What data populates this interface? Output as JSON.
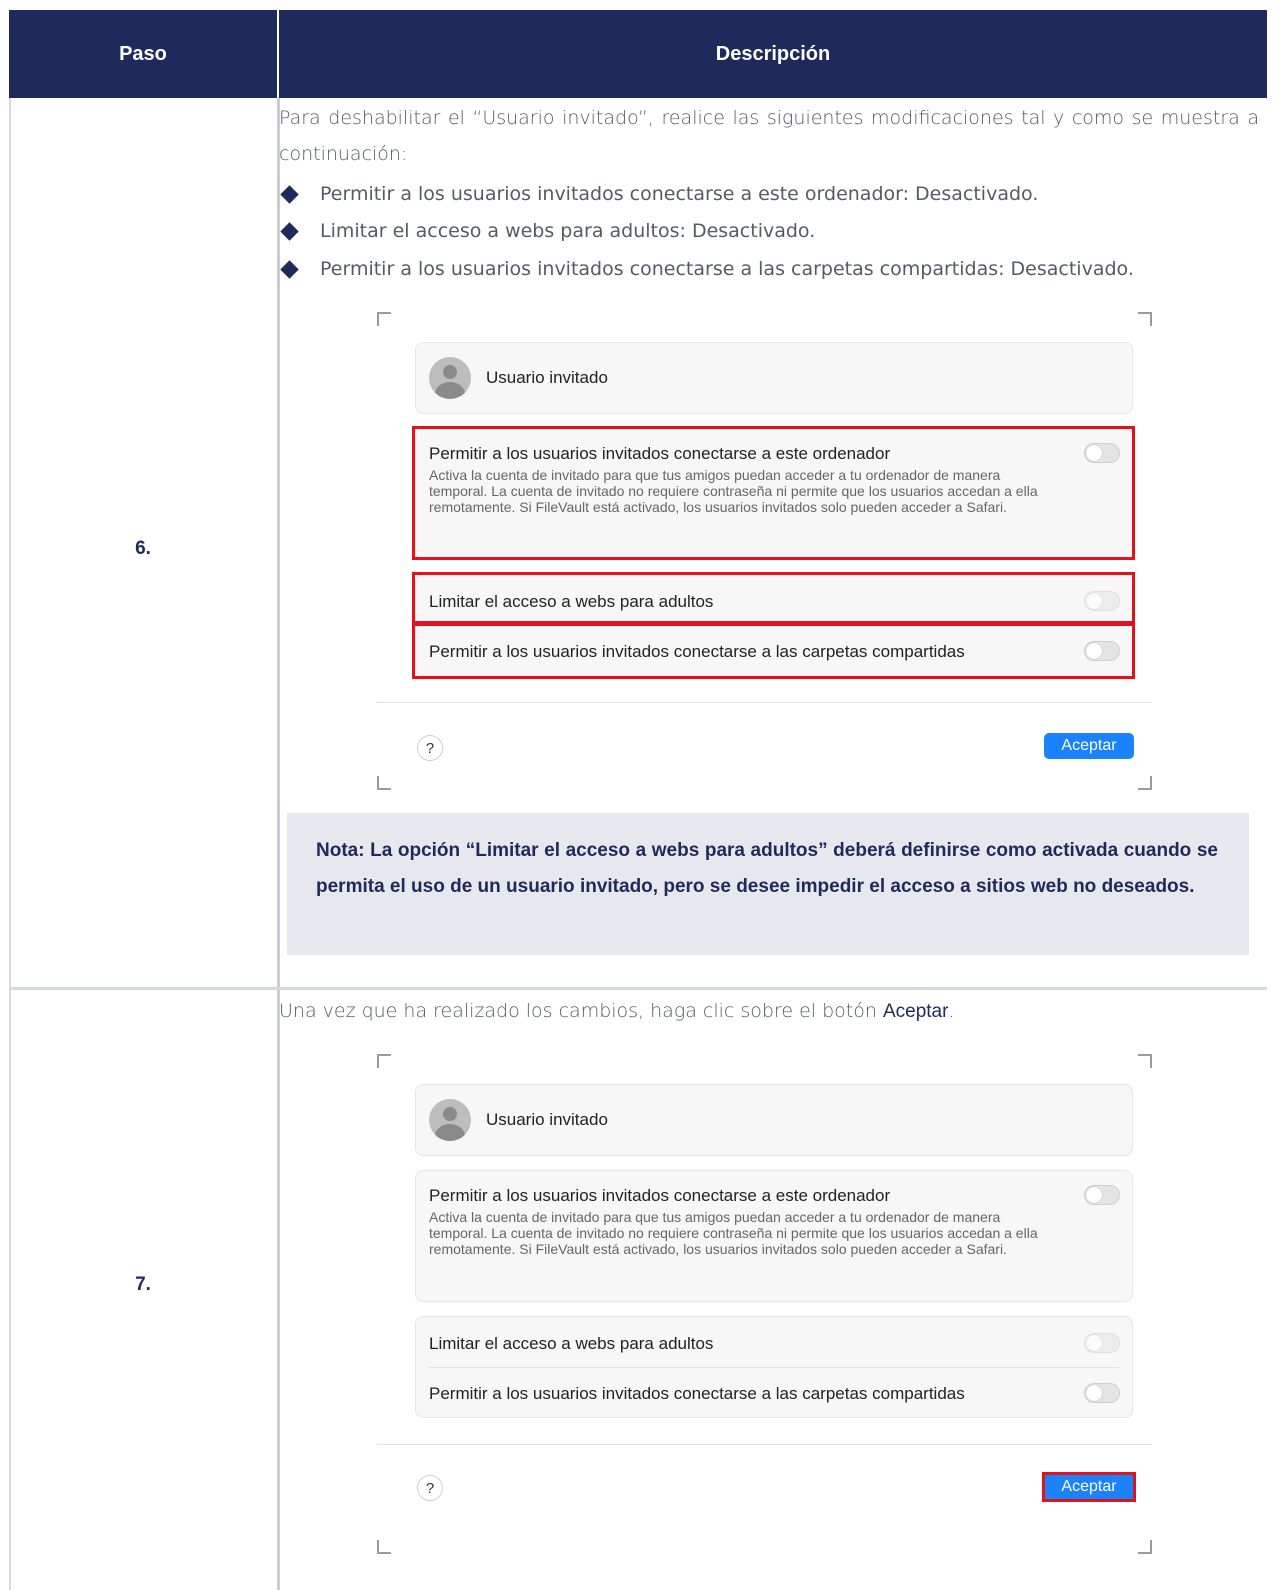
{
  "table": {
    "header": {
      "step": "Paso",
      "description": "Descripción"
    }
  },
  "step6": {
    "number": "6.",
    "intro": "Para deshabilitar el “Usuario invitado”, realice las siguientes modificaciones tal y como se muestra a continuación:",
    "bullets": [
      "Permitir a los usuarios invitados conectarse a este ordenador: Desactivado.",
      "Limitar el acceso a webs para adultos: Desactivado.",
      "Permitir a los usuarios invitados conectarse a las carpetas compartidas: Desactivado."
    ],
    "note": "Nota: La opción “Limitar el acceso a webs para adultos” deberá definirse como activada cuando se permita el uso de un usuario invitado, pero se desee impedir el acceso a sitios web no deseados."
  },
  "step7": {
    "number": "7.",
    "text_before": "Una vez que ha realizado los cambios, haga clic sobre el botón ",
    "text_bold": "Aceptar",
    "text_after": "."
  },
  "dialog": {
    "user_name": "Usuario invitado",
    "option1_title": "Permitir a los usuarios invitados conectarse a este ordenador",
    "option1_desc": "Activa la cuenta de invitado para que tus amigos puedan acceder a tu ordenador de manera temporal. La cuenta de invitado no requiere contraseña ni permite que los usuarios accedan a ella remotamente. Si FileVault está activado, los usuarios invitados solo pueden acceder a Safari.",
    "option2_title": "Limitar el acceso a webs para adultos",
    "option3_title": "Permitir a los usuarios invitados conectarse a las carpetas compartidas",
    "help_label": "?",
    "accept_label": "Aceptar"
  },
  "colors": {
    "header_bg": "#1f2a5c",
    "highlight": "#e0121c",
    "accept_button": "#1a82fb",
    "note_bg": "#e7e8ed"
  }
}
